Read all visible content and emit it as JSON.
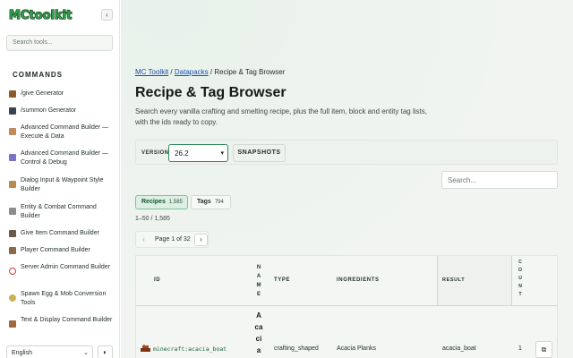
{
  "sidebar": {
    "search_placeholder": "Search tools...",
    "section_title": "COMMANDS",
    "items": [
      {
        "label": "/give Generator",
        "icon": "chest-icon",
        "color": "#8a5a2b"
      },
      {
        "label": "/summon Generator",
        "icon": "spawner-icon",
        "color": "#3a4152"
      },
      {
        "label": "Advanced Command Builder — Execute & Data",
        "icon": "command-block-icon",
        "color": "#c08a5b"
      },
      {
        "label": "Advanced Command Builder — Control & Debug",
        "icon": "command-block-blue-icon",
        "color": "#7a73c9"
      },
      {
        "label": "Dialog Input & Waypoint Style Builder",
        "icon": "sign-icon",
        "color": "#b88a4c"
      },
      {
        "label": "Entity & Combat Command Builder",
        "icon": "sword-icon",
        "color": "#8c8c8c"
      },
      {
        "label": "Give Item Command Builder",
        "icon": "box-icon",
        "color": "#6a5a4a"
      },
      {
        "label": "Player Command Builder",
        "icon": "head-icon",
        "color": "#8a6a45"
      },
      {
        "label": "Server Admin Command Builder",
        "icon": "barrier-icon",
        "color": "#d23b3b"
      },
      {
        "label": "Spawn Egg & Mob Conversion Tools",
        "icon": "spawn-egg-icon",
        "color": "#c9b25a"
      },
      {
        "label": "Text & Display Command Builder",
        "icon": "book-icon",
        "color": "#a06a3a"
      }
    ],
    "language": "English"
  },
  "breadcrumb": {
    "link1": "MC Toolkit",
    "sep1": " / ",
    "link2": "Datapacks",
    "sep2": " / ",
    "current": "Recipe & Tag Browser"
  },
  "page": {
    "title": "Recipe & Tag Browser",
    "description": "Search every vanilla crafting and smelting recipe, plus the full item, block and entity tag lists, with the ids ready to copy."
  },
  "version": {
    "label": "VERSION",
    "selected": "26.2",
    "snapshots_label": "SNAPSHOTS"
  },
  "search": {
    "placeholder": "Search..."
  },
  "tabs": {
    "recipes": {
      "label": "Recipes",
      "count": "1,585"
    },
    "tags": {
      "label": "Tags",
      "count": "794"
    }
  },
  "range_text": "1–50 / 1,585",
  "pager": {
    "prev": "‹",
    "text": "Page 1 of 32",
    "next": "›"
  },
  "table": {
    "headers": {
      "id": "ID",
      "name": "NAME",
      "type": "TYPE",
      "ingredients": "INGREDIENTS",
      "result": "RESULT",
      "count": "COUNT"
    },
    "rows": [
      {
        "id": "minecraft:acacia_boat",
        "name": "Acacia",
        "type": "crafting_shaped",
        "ingredients": "Acacia Planks",
        "result": "acacia_boat",
        "count": "1"
      }
    ]
  },
  "colors": {
    "accent": "#2e8a5a",
    "link": "#1a4fb0"
  }
}
